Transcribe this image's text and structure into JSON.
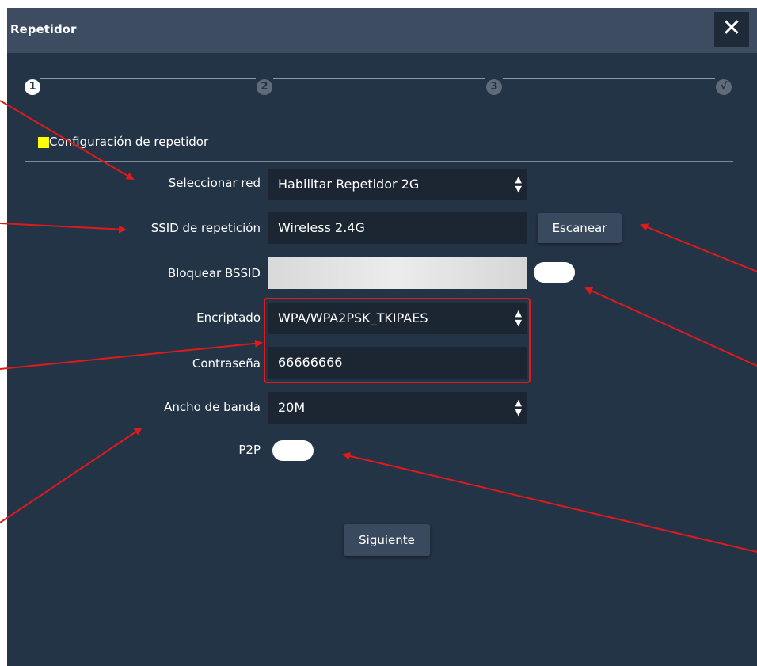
{
  "dialog": {
    "title": "Repetidor",
    "close_icon": "close-icon"
  },
  "steps": [
    "1",
    "2",
    "3",
    "√"
  ],
  "section": {
    "title": "Configuración de repetidor",
    "marker_color": "#ffff00"
  },
  "form": {
    "select_network": {
      "label": "Seleccionar red",
      "value": "Habilitar Repetidor 2G"
    },
    "ssid": {
      "label": "SSID de repetición",
      "value": "Wireless 2.4G"
    },
    "scan_button": "Escanear",
    "bssid": {
      "label": "Bloquear BSSID"
    },
    "encryption": {
      "label": "Encriptado",
      "value": "WPA/WPA2PSK_TKIPAES"
    },
    "password": {
      "label": "Contraseña",
      "value": "66666666"
    },
    "bandwidth": {
      "label": "Ancho de banda",
      "value": "20M"
    },
    "p2p": {
      "label": "P2P"
    },
    "next_button": "Siguiente"
  },
  "colors": {
    "dialog_bg": "#243447",
    "titlebar_bg": "#3d4c60",
    "annotation_red": "#e0191b"
  }
}
